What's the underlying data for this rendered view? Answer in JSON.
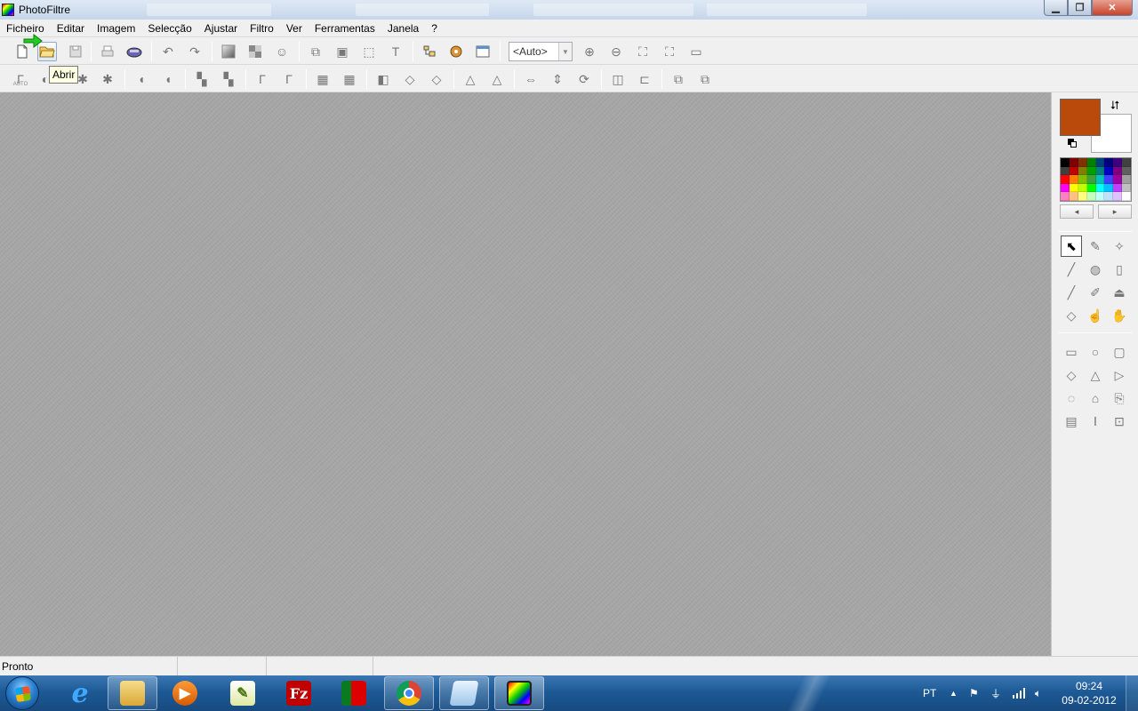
{
  "window": {
    "title": "PhotoFiltre"
  },
  "menu": [
    "Ficheiro",
    "Editar",
    "Imagem",
    "Selecção",
    "Ajustar",
    "Filtro",
    "Ver",
    "Ferramentas",
    "Janela",
    "?"
  ],
  "toolbar": {
    "zoom_value": "<Auto>",
    "tooltip": "Abrir",
    "auto_label": "AUTO"
  },
  "status": {
    "text": "Pronto"
  },
  "colors": {
    "foreground": "#b94a0b",
    "background": "#ffffff",
    "accent": "#c5d6ea",
    "workspace": "#a6a6a6"
  },
  "palette": [
    "#000000",
    "#7f0000",
    "#7f3300",
    "#007f00",
    "#00407f",
    "#00007f",
    "#3f007f",
    "#404040",
    "#3f3f3f",
    "#c00000",
    "#7f7f00",
    "#00a000",
    "#007f7f",
    "#0000c0",
    "#7f007f",
    "#606060",
    "#ff0000",
    "#ff8000",
    "#80c000",
    "#40a040",
    "#00c0c0",
    "#4040ff",
    "#a000a0",
    "#a0a0a0",
    "#ff00ff",
    "#ffff00",
    "#c0ff00",
    "#00ff00",
    "#00ffff",
    "#00c0ff",
    "#c040ff",
    "#c0c0c0",
    "#ff80c0",
    "#ffc080",
    "#ffff80",
    "#c0ffc0",
    "#c0ffff",
    "#c0e0ff",
    "#e0c0ff",
    "#ffffff"
  ],
  "taskbar": {
    "language": "PT",
    "time": "09:24",
    "date": "09-02-2012"
  }
}
